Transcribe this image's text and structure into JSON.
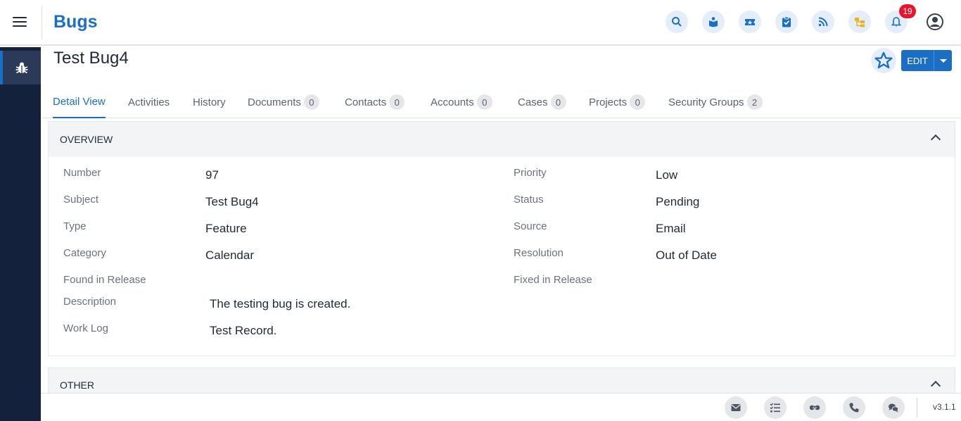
{
  "header": {
    "module_title": "Bugs",
    "notification_count": "19",
    "icons": [
      "search-icon",
      "book-icon",
      "ticket-icon",
      "clipboard-check-icon",
      "rss-icon",
      "hierarchy-icon",
      "bell-icon",
      "user-circle-icon"
    ]
  },
  "sidebar": {
    "items": [
      {
        "icon": "bug-icon"
      }
    ]
  },
  "record": {
    "title": "Test Bug4",
    "edit_label": "EDIT"
  },
  "tabs": [
    {
      "label": "Detail View"
    },
    {
      "label": "Activities"
    },
    {
      "label": "History"
    },
    {
      "label": "Documents",
      "count": "0"
    },
    {
      "label": "Contacts",
      "count": "0"
    },
    {
      "label": "Accounts",
      "count": "0"
    },
    {
      "label": "Cases",
      "count": "0"
    },
    {
      "label": "Projects",
      "count": "0"
    },
    {
      "label": "Security Groups",
      "count": "2"
    }
  ],
  "overview": {
    "heading": "OVERVIEW",
    "left": [
      {
        "label": "Number",
        "value": "97"
      },
      {
        "label": "Subject",
        "value": "Test Bug4"
      },
      {
        "label": "Type",
        "value": "Feature"
      },
      {
        "label": "Category",
        "value": "Calendar"
      },
      {
        "label": "Found in Release",
        "value": ""
      },
      {
        "label": "Description",
        "value": "The testing bug is created."
      },
      {
        "label": "Work Log",
        "value": "Test Record."
      }
    ],
    "right": [
      {
        "label": "Priority",
        "value": "Low"
      },
      {
        "label": "Status",
        "value": "Pending"
      },
      {
        "label": "Source",
        "value": "Email"
      },
      {
        "label": "Resolution",
        "value": "Out of Date"
      },
      {
        "label": "Fixed in Release",
        "value": ""
      }
    ]
  },
  "other": {
    "heading": "OTHER"
  },
  "footer": {
    "icons": [
      "email-icon",
      "tasks-icon",
      "meeting-icon",
      "phone-icon",
      "chat-icon"
    ],
    "version": "v3.1.1"
  },
  "colors": {
    "accent": "#1a6fc4",
    "sidebar": "#14213d",
    "badge": "#e8132c"
  }
}
